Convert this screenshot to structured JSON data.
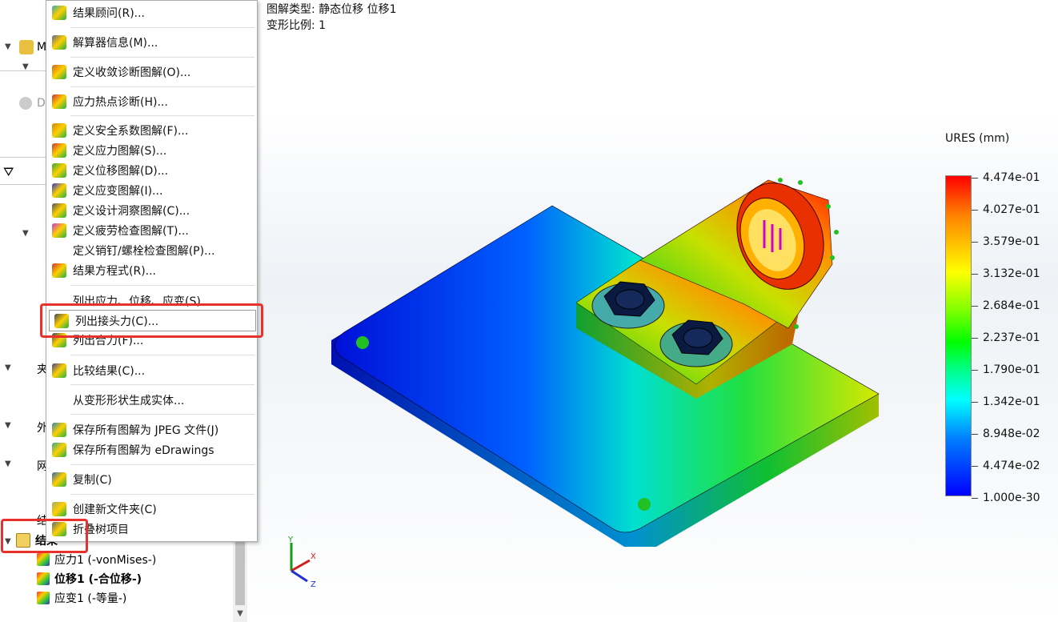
{
  "plot_info": {
    "plot_type": "图解类型: 静态位移 位移1",
    "deform_scale": "变形比例: 1"
  },
  "tree": {
    "partial_labels": [
      "M",
      "D",
      "夹",
      "外",
      "网",
      "结"
    ],
    "results_folder": "结果",
    "items": [
      {
        "label": "应力1 (-vonMises-)",
        "bold": false
      },
      {
        "label": "位移1 (-合位移-)",
        "bold": true
      },
      {
        "label": "应变1 (-等量-)",
        "bold": false
      }
    ]
  },
  "menu": {
    "items": [
      {
        "label": "结果顾问(R)...",
        "icon": "results-advisor-icon"
      },
      {
        "label": "解算器信息(M)...",
        "icon": "solver-info-icon"
      },
      {
        "label": "定义收敛诊断图解(O)...",
        "icon": "convergence-icon"
      },
      {
        "label": "应力热点诊断(H)...",
        "icon": "hotspot-icon"
      },
      {
        "label": "定义安全系数图解(F)...",
        "icon": "fos-plot-icon"
      },
      {
        "label": "定义应力图解(S)...",
        "icon": "stress-plot-icon"
      },
      {
        "label": "定义位移图解(D)...",
        "icon": "displacement-plot-icon"
      },
      {
        "label": "定义应变图解(I)...",
        "icon": "strain-plot-icon"
      },
      {
        "label": "定义设计洞察图解(C)...",
        "icon": "design-insight-icon"
      },
      {
        "label": "定义疲劳检查图解(T)...",
        "icon": "fatigue-icon"
      },
      {
        "label": "定义销钉/螺栓检查图解(P)...",
        "icon": ""
      },
      {
        "label": "结果方程式(R)...",
        "icon": "result-equation-icon"
      },
      {
        "label": "列出应力、位移、应变(S)...",
        "icon": ""
      },
      {
        "label": "列出接头力(C)...",
        "icon": "connector-force-icon"
      },
      {
        "label": "列出合力(F)...",
        "icon": "resultant-force-icon"
      },
      {
        "label": "比较结果(C)...",
        "icon": "compare-icon"
      },
      {
        "label": "从变形形状生成实体...",
        "icon": ""
      },
      {
        "label": "保存所有图解为 JPEG 文件(J)",
        "icon": "jpeg-icon"
      },
      {
        "label": "保存所有图解为 eDrawings",
        "icon": "edrawings-icon"
      },
      {
        "label": "复制(C)",
        "icon": "copy-icon"
      },
      {
        "label": "创建新文件夹(C)",
        "icon": "new-folder-icon"
      },
      {
        "label": "折叠树项目",
        "icon": "collapse-icon"
      }
    ]
  },
  "legend": {
    "title": "URES (mm)",
    "labels": [
      "4.474e-01",
      "4.027e-01",
      "3.579e-01",
      "3.132e-01",
      "2.684e-01",
      "2.237e-01",
      "1.790e-01",
      "1.342e-01",
      "8.948e-02",
      "4.474e-02",
      "1.000e-30"
    ],
    "colors": [
      "#ff0000",
      "#ff8000",
      "#ffff00",
      "#00ff00",
      "#00ffff",
      "#0000ff"
    ]
  },
  "triad": {
    "x": "X",
    "y": "Y",
    "z": "Z"
  }
}
